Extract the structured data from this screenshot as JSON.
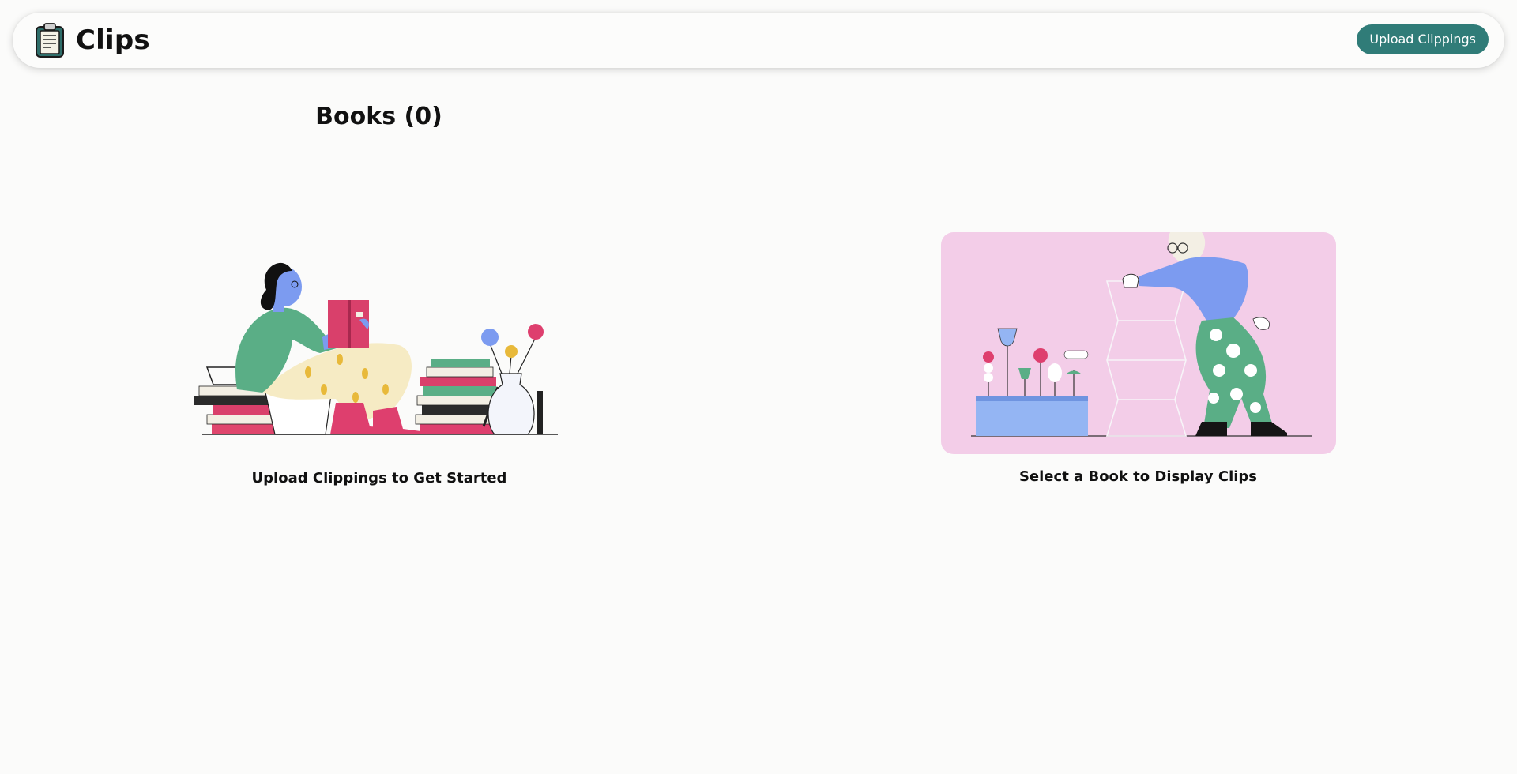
{
  "app": {
    "name": "Clips",
    "logo_icon": "clipboard-icon"
  },
  "header": {
    "upload_button_label": "Upload Clippings"
  },
  "books_panel": {
    "title": "Books (0)",
    "empty_message": "Upload Clippings to Get Started",
    "illustration": "woman-reading-illustration"
  },
  "clips_panel": {
    "empty_message": "Select a Book to Display Clips",
    "illustration": "person-unfolding-paper-illustration"
  },
  "colors": {
    "accent": "#307c78",
    "background": "#fbfbfa",
    "illustration_pink": "#f3cde8"
  }
}
